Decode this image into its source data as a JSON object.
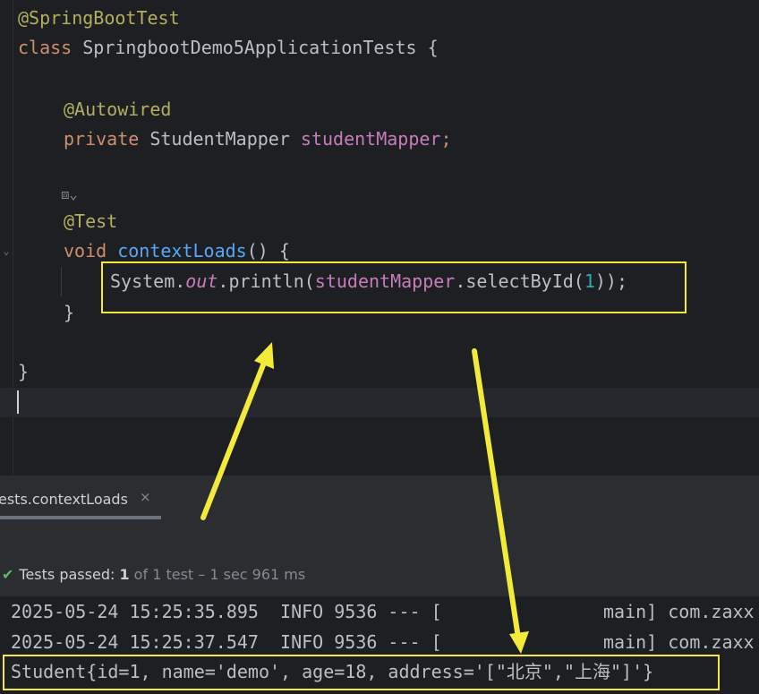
{
  "editor": {
    "lines": {
      "annotation_springboottest": "@SpringBootTest",
      "class_kw": "class",
      "class_name": " SpringbootDemo5ApplicationTests {",
      "annotation_autowired": "@Autowired",
      "private_kw": "private",
      "field_type": " StudentMapper ",
      "field_name": "studentMapper",
      "field_end": ";",
      "annotation_test": "@Test",
      "void_kw": "void",
      "method_name": " contextLoads",
      "method_rest": "() {",
      "stmt_system": "System.",
      "stmt_out": "out",
      "stmt_println": ".println(",
      "stmt_mapper": "studentMapper",
      "stmt_select": ".selectById(",
      "stmt_num": "1",
      "stmt_end": "));",
      "close_method": "}",
      "close_class": "}"
    },
    "gen_icon": "run-test-icon",
    "gen_icon_glyph": "⧈⌄"
  },
  "run_window": {
    "tab_label": "ests.contextLoads",
    "tab_close": "×",
    "status": {
      "check": "✔",
      "passed_label": "Tests passed: ",
      "passed_count": "1",
      "detail": " of 1 test – 1 sec 961 ms"
    }
  },
  "console": {
    "log1_left": "2025-05-24 15:25:35.895  INFO 9536 --- [",
    "log1_right": "main] com.zaxx",
    "log2_left": "2025-05-24 15:25:37.547  INFO 9536 --- [",
    "log2_right": "main] com.zaxx",
    "result": "Student{id=1, name='demo', age=18, address='[\"北京\",\"上海\"]'}"
  },
  "colors": {
    "highlight": "#f3ea3a",
    "background": "#1e1f22",
    "pass_green": "#5fb865"
  }
}
